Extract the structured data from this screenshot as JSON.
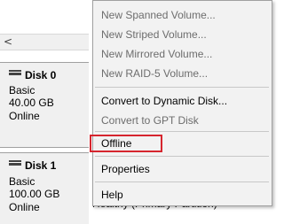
{
  "disks": [
    {
      "name": "Disk 0",
      "type": "Basic",
      "size": "40.00 GB",
      "status": "Online"
    },
    {
      "name": "Disk 1",
      "type": "Basic",
      "size": "100.00 GB",
      "status": "Online"
    }
  ],
  "scrollbar": {
    "left_arrow": "<"
  },
  "volume_status_partial": "Healthy (Primary Partition)",
  "context_menu": {
    "items": [
      {
        "label": "New Spanned Volume...",
        "enabled": false
      },
      {
        "label": "New Striped Volume...",
        "enabled": false
      },
      {
        "label": "New Mirrored Volume...",
        "enabled": false
      },
      {
        "label": "New RAID-5 Volume...",
        "enabled": false
      },
      {
        "label": "Convert to Dynamic Disk...",
        "enabled": true
      },
      {
        "label": "Convert to GPT Disk",
        "enabled": false
      },
      {
        "label": "Offline",
        "enabled": true,
        "highlighted": true
      },
      {
        "label": "Properties",
        "enabled": true
      },
      {
        "label": "Help",
        "enabled": true
      }
    ]
  },
  "colors": {
    "highlight_border": "#d6252e",
    "disabled_text": "#6d6d6d",
    "menu_background": "#f2f2f2",
    "disk_panel_background": "#f0f0f0"
  }
}
